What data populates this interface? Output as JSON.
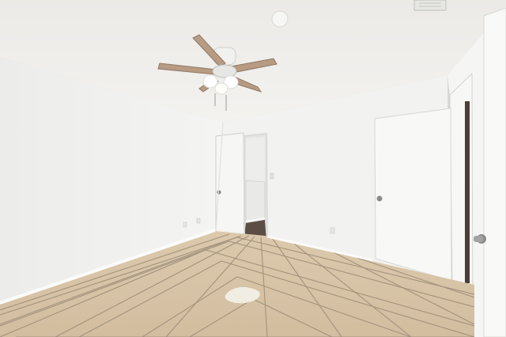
{
  "image": {
    "scene": "empty-bedroom",
    "colors": {
      "ceiling": "#efefed",
      "wall_left": "#f1f1ef",
      "wall_back": "#f3f3f1",
      "wall_right": "#f6f6f4",
      "floor_tile": "#d9c6aa",
      "grout": "#9c8e7a",
      "baseboard": "#fbfbfa",
      "fan_blade": "#b59a82",
      "fan_light": "#ffffff",
      "door": "#f8f8f6",
      "knob": "#8e8e8e",
      "closet_floor": "#5b4f45"
    }
  }
}
